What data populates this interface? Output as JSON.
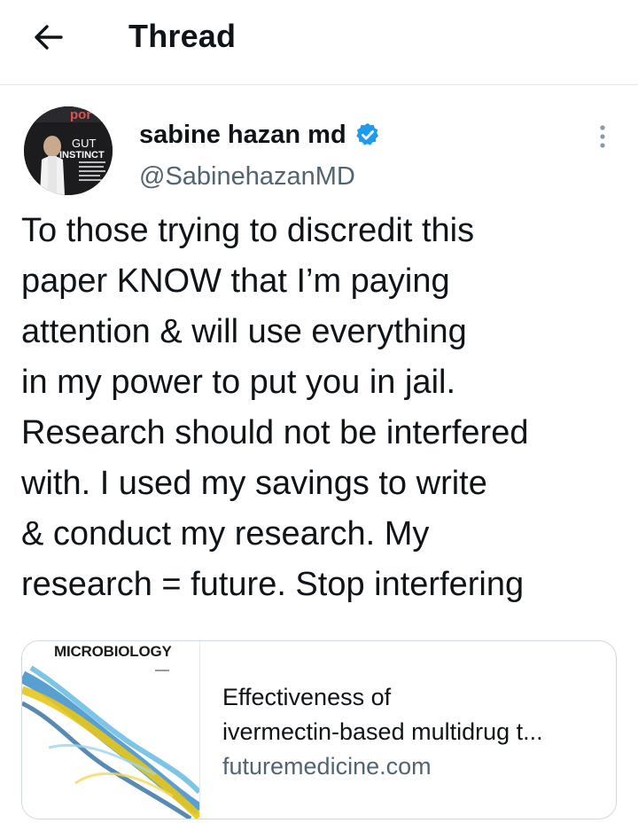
{
  "header": {
    "title": "Thread",
    "back_icon": "arrow-left-icon"
  },
  "tweet": {
    "author": {
      "display_name": "sabine hazan md",
      "handle": "@SabinehazanMD",
      "verified": true,
      "verified_color": "#1d9bf0",
      "avatar_text": {
        "top": "por",
        "title_line1": "GUT",
        "title_line2": "INSTINCT"
      }
    },
    "text_lines": [
      "To those trying to discredit this",
      "paper KNOW that I’m paying",
      "attention & will use everything",
      "in my power to put you in jail.",
      "Research should not be interfered",
      "with. I used my savings to write",
      "& conduct my research. My",
      "research = future. Stop interfering"
    ],
    "card": {
      "image_title": "MICROBIOLOGY",
      "title_line1": "Effectiveness of",
      "title_line2": "ivermectin-based multidrug t...",
      "domain": "futuremedicine.com"
    }
  },
  "colors": {
    "text": "#0f1419",
    "secondary": "#536471",
    "border": "#cfd9de",
    "divider": "#e6e9eb"
  }
}
